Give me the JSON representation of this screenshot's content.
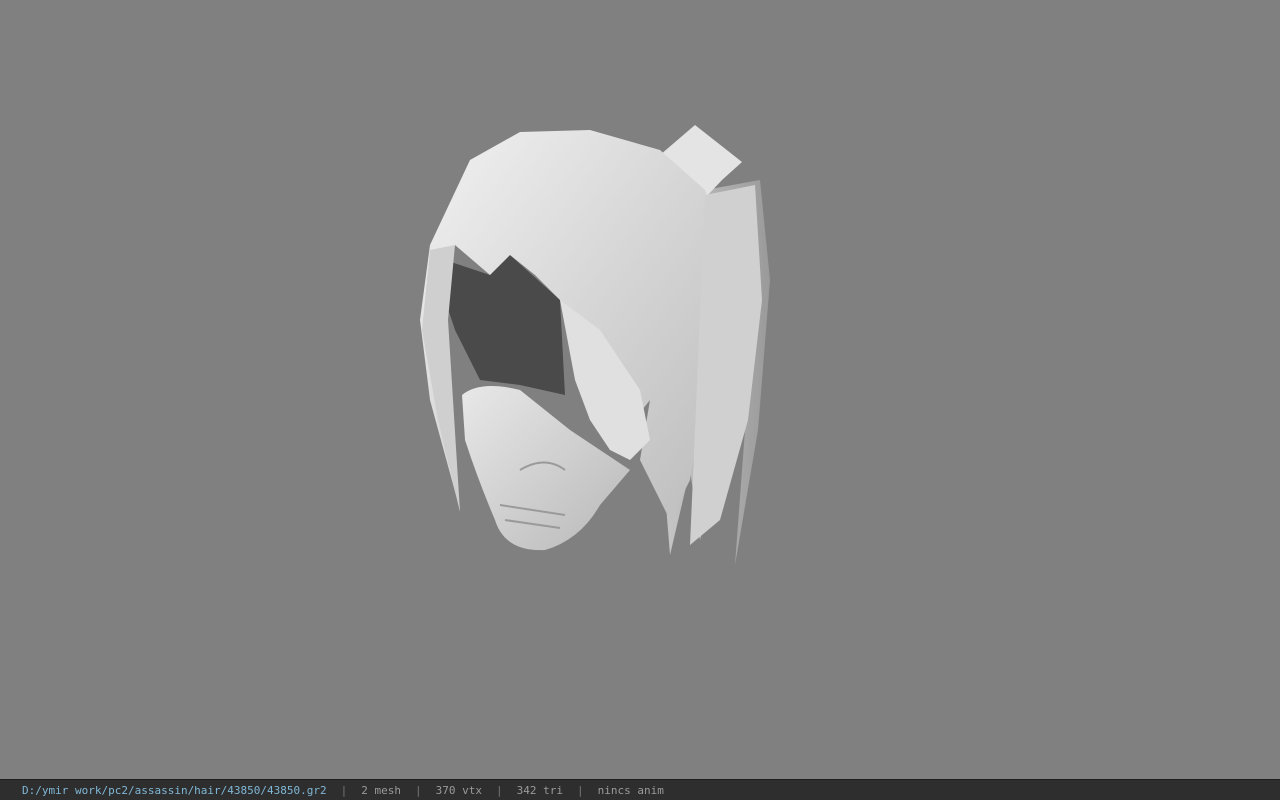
{
  "viewer": {
    "background_color": "#808080",
    "model_description_icon": "hair-mesh-model"
  },
  "status": {
    "file_path": "D:/ymir work/pc2/assassin/hair/43850/43850.gr2",
    "separator": "|",
    "mesh_count": "2 mesh",
    "vertex_count": "370 vtx",
    "triangle_count": "342 tri",
    "anim_info": "nincs anim",
    "path_color": "#7fb7d6"
  }
}
